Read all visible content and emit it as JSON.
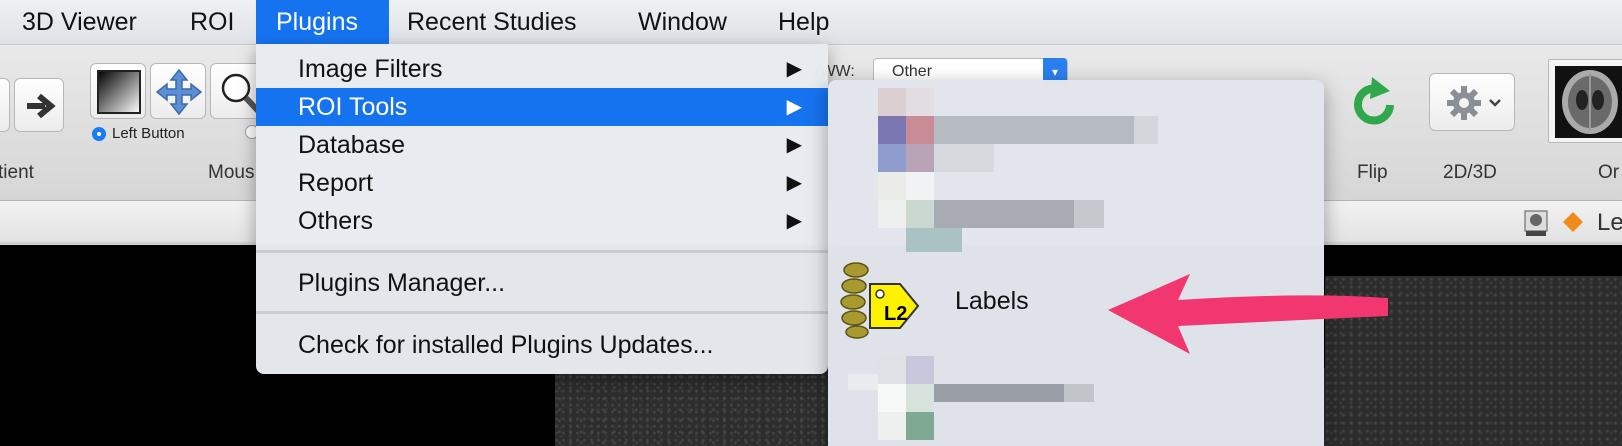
{
  "menubar": {
    "items": [
      {
        "label": "3D Viewer",
        "active": false
      },
      {
        "label": "ROI",
        "active": false
      },
      {
        "label": "Plugins",
        "active": true
      },
      {
        "label": "Recent Studies",
        "active": false
      },
      {
        "label": "Window",
        "active": false
      },
      {
        "label": "Help",
        "active": false
      }
    ]
  },
  "toolbar": {
    "left_radio_label": "Left Button",
    "patient_label_partial": "tient",
    "mouse_label_partial": "Mous",
    "ww_label_partial": "/WW:",
    "ww_select_value": "Other",
    "flip_label": "Flip",
    "twod3d_label": "2D/3D",
    "orientation_label_partial": "Or",
    "status_label_partial": "Le"
  },
  "plugins_menu": {
    "items": [
      {
        "label": "Image Filters",
        "submenu_glyph": "▶"
      },
      {
        "label": "ROI Tools",
        "submenu_glyph": "▶"
      },
      {
        "label": "Database",
        "submenu_glyph": "▶"
      },
      {
        "label": "Report",
        "submenu_glyph": "▶"
      },
      {
        "label": "Others",
        "submenu_glyph": "▶"
      }
    ],
    "manager_label": "Plugins Manager...",
    "updates_label": "Check for installed Plugins Updates..."
  },
  "roi_tools_submenu": {
    "labels_item": "Labels",
    "labels_icon_text": "L2"
  },
  "colors": {
    "highlight": "#1673f0",
    "arrow": "#f2366f",
    "flip_green": "#2ea84a"
  }
}
